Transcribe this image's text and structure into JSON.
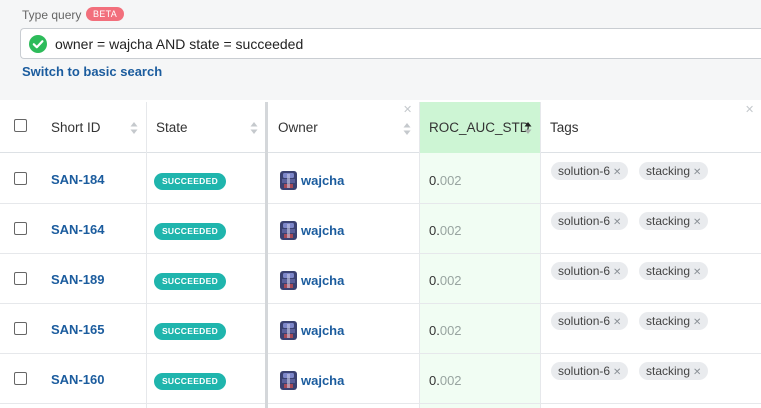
{
  "query": {
    "label": "Type query",
    "beta": "BETA",
    "text": "owner = wajcha AND state = succeeded",
    "switch_link": "Switch to basic search"
  },
  "columns": {
    "short_id": "Short ID",
    "state": "State",
    "owner": "Owner",
    "roc": "ROC_AUC_STD",
    "tags": "Tags"
  },
  "icons": {
    "valid_query": "check-circle-icon",
    "sort": "sort-icon",
    "sort_asc": "sort-ascending-icon",
    "remove_column": "close-icon",
    "avatar": "user-avatar-icon",
    "remove_tag": "close-icon"
  },
  "colors": {
    "accent_link": "#1b5c9e",
    "state_badge": "#1fb5ad",
    "beta_badge": "#f26f7c",
    "sorted_column": "#cdf5d4",
    "valid_check": "#2dbb5a"
  },
  "rows": [
    {
      "id": "SAN-184",
      "state": "SUCCEEDED",
      "owner": "wajcha",
      "roc_int": "0.",
      "roc_frac": "002",
      "tags": [
        "solution-6",
        "stacking"
      ]
    },
    {
      "id": "SAN-164",
      "state": "SUCCEEDED",
      "owner": "wajcha",
      "roc_int": "0.",
      "roc_frac": "002",
      "tags": [
        "solution-6",
        "stacking"
      ]
    },
    {
      "id": "SAN-189",
      "state": "SUCCEEDED",
      "owner": "wajcha",
      "roc_int": "0.",
      "roc_frac": "002",
      "tags": [
        "solution-6",
        "stacking"
      ]
    },
    {
      "id": "SAN-165",
      "state": "SUCCEEDED",
      "owner": "wajcha",
      "roc_int": "0.",
      "roc_frac": "002",
      "tags": [
        "solution-6",
        "stacking"
      ]
    },
    {
      "id": "SAN-160",
      "state": "SUCCEEDED",
      "owner": "wajcha",
      "roc_int": "0.",
      "roc_frac": "002",
      "tags": [
        "solution-6",
        "stacking"
      ]
    }
  ],
  "tag_remove_glyph": "✕"
}
